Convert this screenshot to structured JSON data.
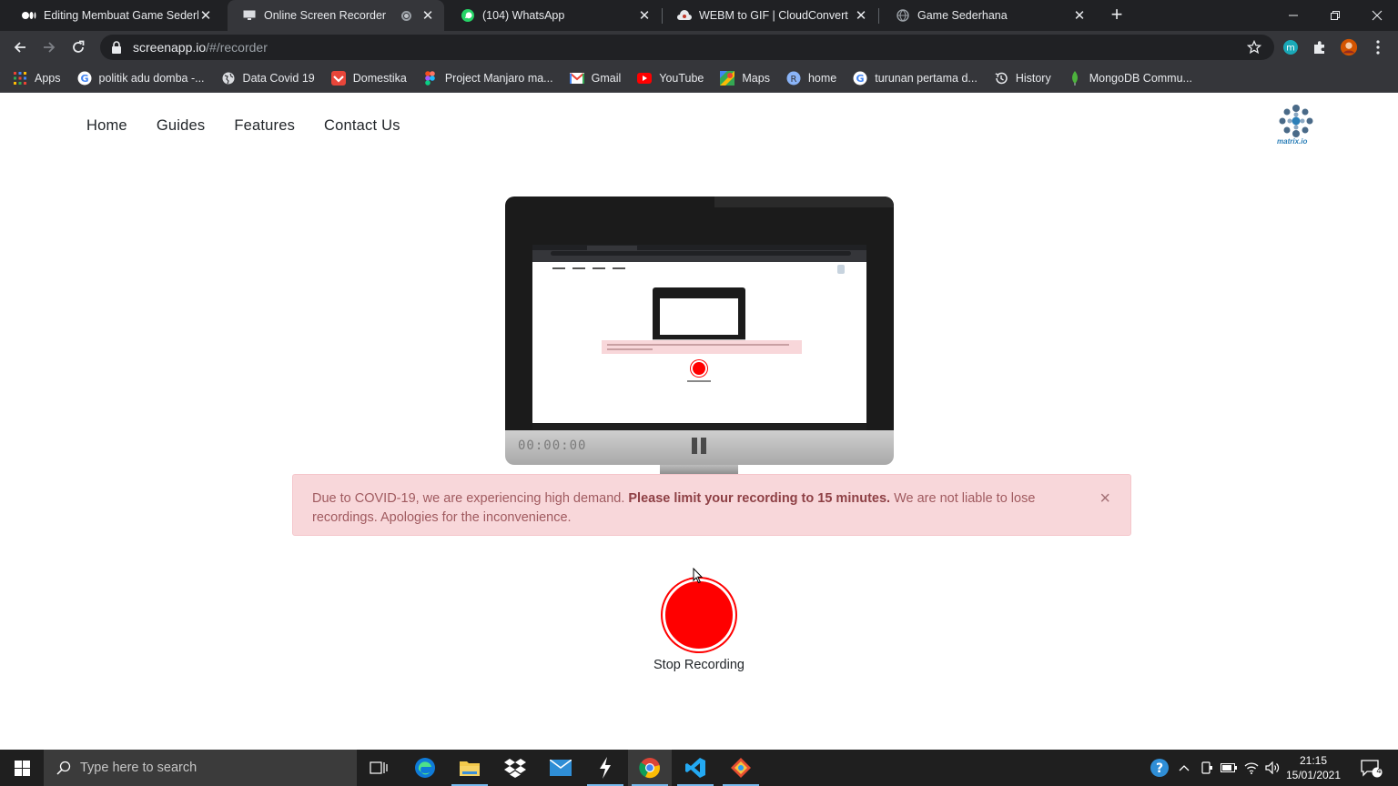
{
  "tabs": [
    {
      "title": "Editing Membuat Game Sederhana",
      "icon": "medium-icon"
    },
    {
      "title": "Online Screen Recorder",
      "icon": "screen-recorder-icon",
      "active": true
    },
    {
      "title": "(104) WhatsApp",
      "icon": "whatsapp-icon"
    },
    {
      "title": "WEBM to GIF | CloudConvert",
      "icon": "cloudconvert-icon"
    },
    {
      "title": "Game Sederhana",
      "icon": "globe-icon"
    }
  ],
  "address": {
    "host": "screenapp.io",
    "path": "/#/recorder"
  },
  "bookmarks": [
    {
      "label": "Apps",
      "icon": "apps-grid-icon"
    },
    {
      "label": "politik adu domba -...",
      "icon": "google-icon"
    },
    {
      "label": "Data Covid 19",
      "icon": "globe-icon"
    },
    {
      "label": "Domestika",
      "icon": "domestika-icon"
    },
    {
      "label": "Project Manjaro ma...",
      "icon": "figma-icon"
    },
    {
      "label": "Gmail",
      "icon": "gmail-icon"
    },
    {
      "label": "YouTube",
      "icon": "youtube-icon"
    },
    {
      "label": "Maps",
      "icon": "maps-icon"
    },
    {
      "label": "home",
      "icon": "home-bookmark-icon"
    },
    {
      "label": "turunan pertama d...",
      "icon": "google-icon"
    },
    {
      "label": "History",
      "icon": "history-icon"
    },
    {
      "label": "MongoDB Commu...",
      "icon": "mongodb-icon"
    }
  ],
  "site_nav": [
    "Home",
    "Guides",
    "Features",
    "Contact Us"
  ],
  "logo_text": "matrix.io",
  "recorder": {
    "timer": "00:00:00"
  },
  "alert": {
    "text_before": "Due to COVID-19, we are experiencing high demand. ",
    "text_bold": "Please limit your recording to 15 minutes.",
    "text_after": " We are not liable to lose recordings. Apologies for the inconvenience.",
    "close": "×"
  },
  "record_button": {
    "label": "Stop Recording",
    "color": "#ff0000"
  },
  "taskbar": {
    "search_placeholder": "Type here to search",
    "time": "21:15",
    "date": "15/01/2021",
    "notification_count": "4"
  }
}
